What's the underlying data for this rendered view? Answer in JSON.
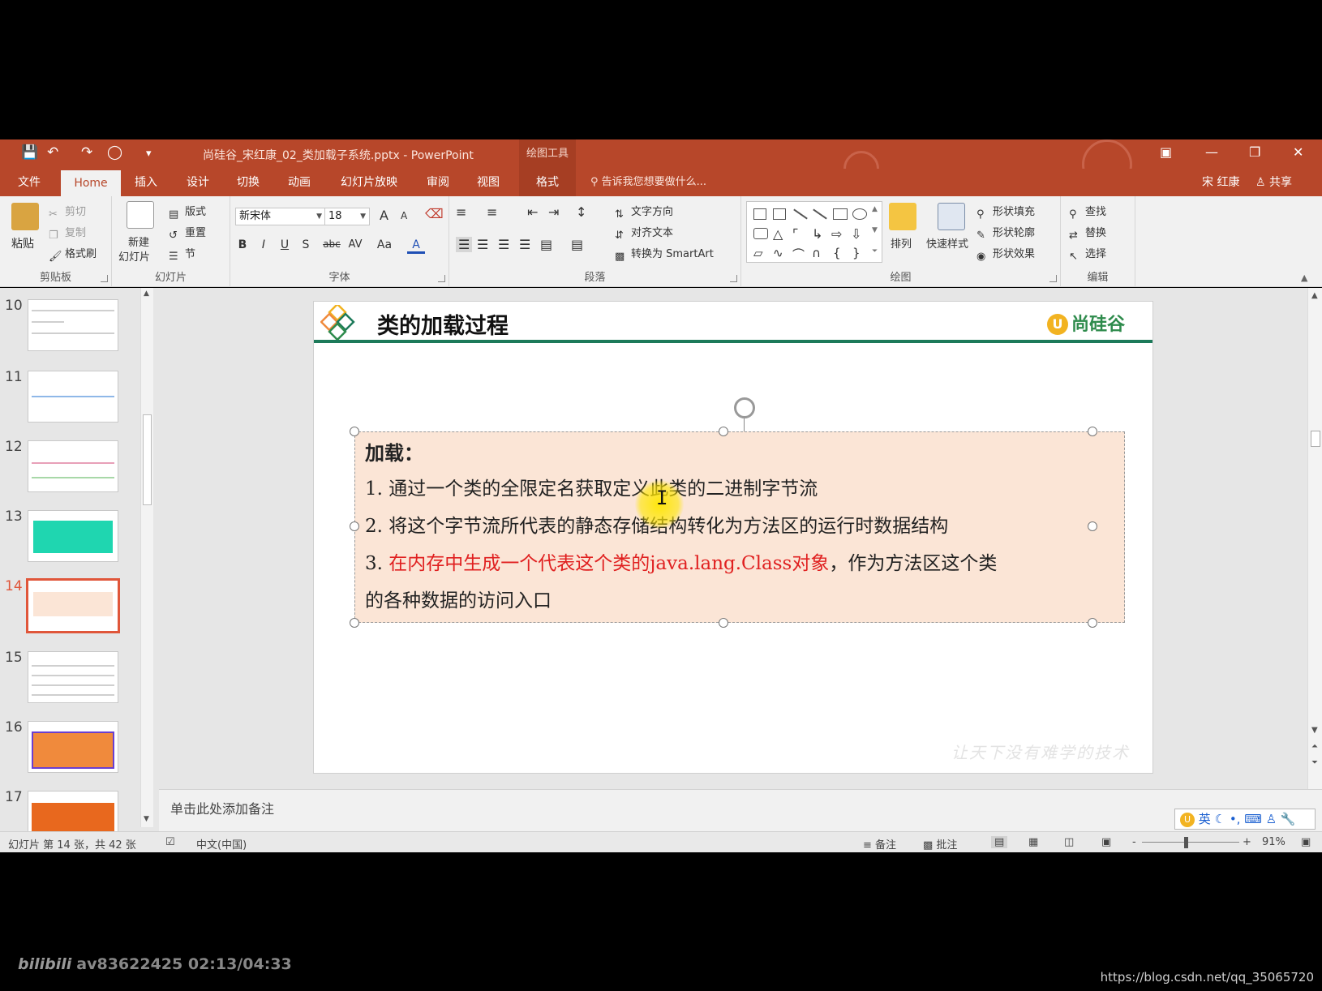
{
  "titlebar": {
    "document_title": "尚硅谷_宋红康_02_类加载子系统.pptx - PowerPoint",
    "contextual_tab_group": "绘图工具",
    "icons": [
      "save-icon",
      "undo-icon",
      "redo-icon",
      "start-from-beginning-icon",
      "customize-toolbar-icon",
      "ribbon-display-icon",
      "minimize-icon",
      "restore-icon",
      "close-icon"
    ]
  },
  "tabs": {
    "items": [
      "文件",
      "Home",
      "插入",
      "设计",
      "切换",
      "动画",
      "幻灯片放映",
      "审阅",
      "视图",
      "格式"
    ],
    "active": "Home",
    "tell_me_placeholder": "告诉我您想要做什么...",
    "user_name": "宋 红康",
    "share_label": "共享"
  },
  "ribbon": {
    "clipboard": {
      "label": "剪贴板",
      "paste": "粘贴",
      "cut": "剪切",
      "copy": "复制",
      "format_painter": "格式刷"
    },
    "slides": {
      "label": "幻灯片",
      "new_slide_line1": "新建",
      "new_slide_line2": "幻灯片",
      "layout": "版式",
      "reset": "重置",
      "section": "节"
    },
    "font": {
      "label": "字体",
      "font_name": "新宋体",
      "font_size": "18",
      "bold": "B",
      "italic": "I",
      "underline": "U",
      "shadow": "S",
      "strikethrough": "abc",
      "spacing": "AV",
      "change_case": "Aa",
      "font_color": "A",
      "grow": "A",
      "shrink": "A"
    },
    "paragraph": {
      "label": "段落",
      "text_direction": "文字方向",
      "align_text": "对齐文本",
      "convert_smartart": "转换为 SmartArt"
    },
    "drawing": {
      "label": "绘图",
      "arrange": "排列",
      "quick_styles": "快速样式",
      "shape_fill": "形状填充",
      "shape_outline": "形状轮廓",
      "shape_effects": "形状效果"
    },
    "editing": {
      "label": "编辑",
      "find": "查找",
      "replace": "替换",
      "select": "选择"
    }
  },
  "thumbnails": {
    "numbers": [
      "10",
      "11",
      "12",
      "13",
      "14",
      "15",
      "16",
      "17"
    ],
    "active": "14"
  },
  "slide": {
    "title": "类的加载过程",
    "brand": "尚硅谷",
    "brand_mark": "U",
    "slogan": "让天下没有难学的技术",
    "heading": "加载：",
    "line1": "1. 通过一个类的全限定名获取定义此类的二进制字节流",
    "line2": "2. 将这个字节流所代表的静态存储结构转化为方法区的运行时数据结构",
    "line3_prefix": "3. ",
    "line3_red": "在内存中生成一个代表这个类的java.lang.Class对象",
    "line3_rest": "，作为方法区这个类",
    "line4": "的各种数据的访问入口"
  },
  "notes": {
    "placeholder": "单击此处添加备注"
  },
  "ime": {
    "label": "英"
  },
  "statusbar": {
    "slide_info": "幻灯片 第 14 张，共 42 张",
    "language": "中文(中国)",
    "notes": "备注",
    "comments": "批注",
    "zoom": "91%",
    "zoom_minus": "-",
    "zoom_plus": "+"
  },
  "video_overlay": {
    "video_id": "av83622425 02:13/04:33",
    "watermark": "https://blog.csdn.net/qq_35065720"
  },
  "colors": {
    "ppt_accent": "#b7472a",
    "title_rule": "#1d7a5a",
    "textbox_fill": "#fbe5d6",
    "red_text": "#e02020",
    "active_thumb_border": "#e0563a"
  }
}
